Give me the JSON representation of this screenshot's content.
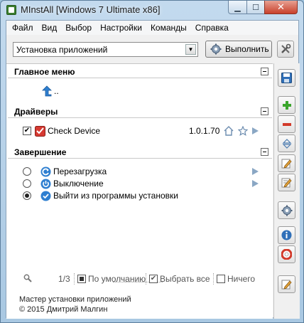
{
  "window": {
    "title": "MInstAll [Windows 7 Ultimate x86]",
    "close_glyph": "✕",
    "min_glyph": "▁",
    "max_glyph": "☐"
  },
  "menu": [
    "Файл",
    "Вид",
    "Выбор",
    "Настройки",
    "Команды",
    "Справка"
  ],
  "toolbar": {
    "profile_value": "Установка приложений",
    "run_label": "Выполнить"
  },
  "sections": {
    "main_menu": {
      "title": "Главное меню",
      "up_label": ".."
    },
    "drivers": {
      "title": "Драйверы",
      "items": [
        {
          "label": "Check Device",
          "version": "1.0.1.70",
          "checked": true
        }
      ]
    },
    "finish": {
      "title": "Завершение",
      "options": [
        {
          "label": "Перезагрузка",
          "selected": false
        },
        {
          "label": "Выключение",
          "selected": false
        },
        {
          "label": "Выйти из программы установки",
          "selected": true
        }
      ]
    }
  },
  "status": {
    "page": "1/3",
    "default_label": "По умолчанию",
    "select_all_label": "Выбрать все",
    "none_label": "Ничего"
  },
  "footer": {
    "line1": "Мастер установки приложений",
    "line2": "© 2015 Дмитрий Малгин"
  },
  "colors": {
    "accent_blue": "#2f6fb8",
    "green": "#3aa52b",
    "red": "#d23a2a"
  }
}
